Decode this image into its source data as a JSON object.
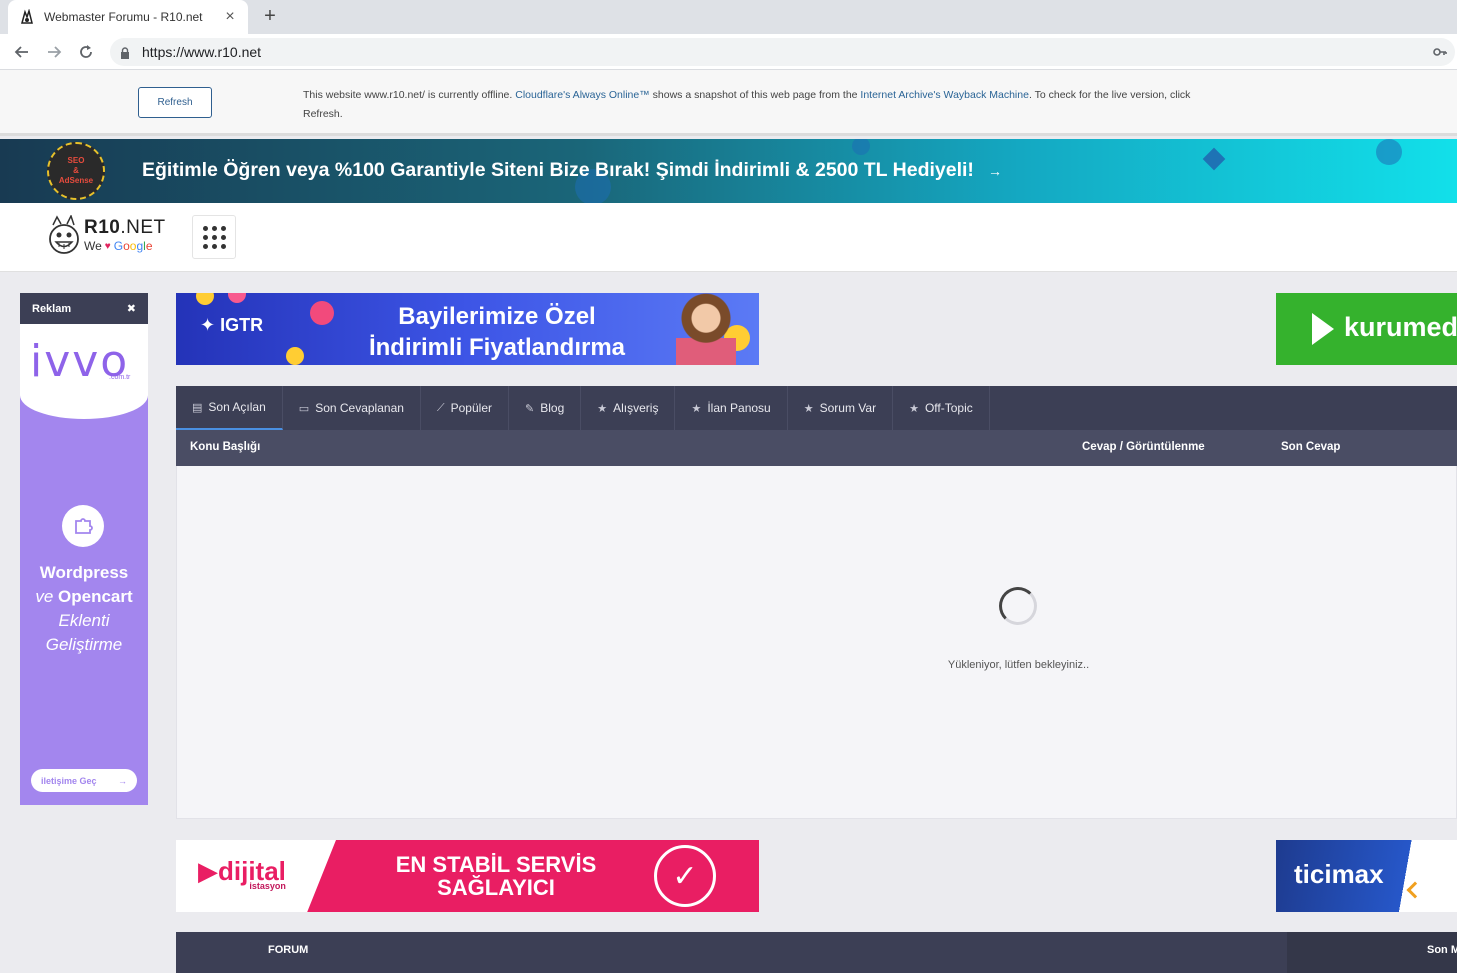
{
  "browser": {
    "tab_title": "Webmaster Forumu - R10.net",
    "tab_close": "×",
    "new_tab": "+",
    "url": "https://www.r10.net"
  },
  "cloudflare": {
    "refresh_label": "Refresh",
    "text_1": "This website www.r10.net/ is currently offline. ",
    "link_1": "Cloudflare's Always Online™",
    "text_2": " shows a snapshot of this web page from the ",
    "link_2": "Internet Archive's Wayback Machine",
    "text_3": ". To check for the live version, click Refresh."
  },
  "promo": {
    "badge_line1": "SEO",
    "badge_line2": "&",
    "badge_line3": "AdSense",
    "text": "Eğitimle Öğren veya %100 Garantiyle Siteni Bize Bırak! Şimdi İndirimli & 2500 TL Hediyeli!",
    "arrow": "→"
  },
  "header": {
    "logo_main_bold": "R10",
    "logo_main_rest": ".NET",
    "logo_we": "We",
    "logo_heart": "♥",
    "logo_google": [
      "G",
      "o",
      "o",
      "g",
      "l",
      "e"
    ]
  },
  "side_ad": {
    "label": "Reklam",
    "close": "✖",
    "brand": "ivvo",
    "brand_sub": ".com.tr",
    "line1": "Wordpress",
    "line2_a": "ve ",
    "line2_b": "Opencart",
    "line3": "Eklenti",
    "line4": "Geliştirme",
    "cta": "iletişime Geç",
    "cta_arrow": "→"
  },
  "ads": {
    "igtr_logo": "IGTR",
    "igtr_line1": "Bayilerimize Özel",
    "igtr_line2": "İndirimli Fiyatlandırma",
    "kurumed": "kurumed",
    "dijital_logo": "dijital",
    "dijital_logo_sub": "istasyon",
    "dijital_line1": "EN STABİL SERVİS",
    "dijital_line2": "SAĞLAYICI",
    "dijital_check": "✓",
    "ticimax": "ticimax"
  },
  "forum": {
    "tabs": [
      {
        "label": "Son Açılan",
        "icon": "📄"
      },
      {
        "label": "Son Cevaplanan",
        "icon": "💬"
      },
      {
        "label": "Popüler",
        "icon": "〰"
      },
      {
        "label": "Blog",
        "icon": "✎"
      },
      {
        "label": "Alışveriş",
        "icon": "★"
      },
      {
        "label": "İlan Panosu",
        "icon": "★"
      },
      {
        "label": "Sorum Var",
        "icon": "★"
      },
      {
        "label": "Off-Topic",
        "icon": "★"
      }
    ],
    "col_title": "Konu Başlığı",
    "col_replies": "Cevap / Görüntülenme",
    "col_last": "Son Cevap",
    "loading": "Yükleniyor, lütfen bekleyiniz.."
  },
  "bottom": {
    "forum_label": "FORUM",
    "right_label": "Son M"
  },
  "colors": {
    "nav_dark": "#3c3f55",
    "accent_blue": "#4a90e2",
    "ivvo_purple": "#a386ee",
    "kurumed_green": "#35b22d",
    "dijital_pink": "#e91e63"
  }
}
